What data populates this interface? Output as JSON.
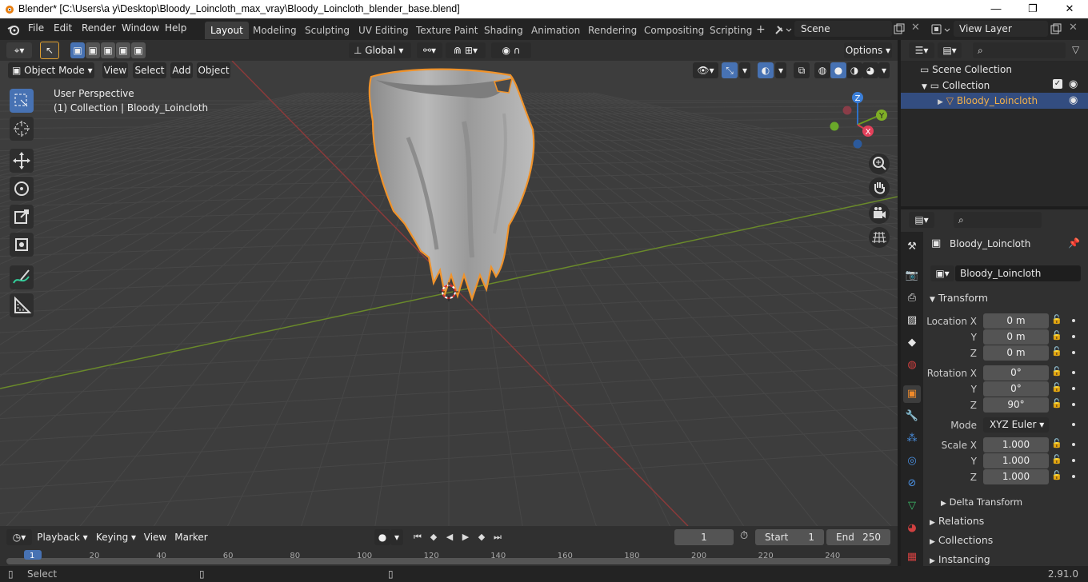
{
  "window": {
    "title": "Blender* [C:\\Users\\a y\\Desktop\\Bloody_Loincloth_max_vray\\Bloody_Loincloth_blender_base.blend]",
    "controls": [
      "—",
      "❐",
      "✕"
    ]
  },
  "menu": [
    "File",
    "Edit",
    "Render",
    "Window",
    "Help"
  ],
  "workspaces": [
    "Layout",
    "Modeling",
    "Sculpting",
    "UV Editing",
    "Texture Paint",
    "Shading",
    "Animation",
    "Rendering",
    "Compositing",
    "Scripting"
  ],
  "active_workspace": "Layout",
  "scene": {
    "value": "Scene"
  },
  "view_layer": {
    "value": "View Layer"
  },
  "viewport_header": {
    "transform_orientation": "Global",
    "options": "Options",
    "mode": "Object Mode",
    "menus": [
      "View",
      "Select",
      "Add",
      "Object"
    ]
  },
  "viewport": {
    "perspective": "User Perspective",
    "collection_info": "(1) Collection | Bloody_Loincloth"
  },
  "gizmo": {
    "z": "Z",
    "y": "Y",
    "x": "X"
  },
  "outliner": {
    "root": "Scene Collection",
    "collection": "Collection",
    "object": "Bloody_Loincloth"
  },
  "properties": {
    "object_name": "Bloody_Loincloth",
    "data_name": "Bloody_Loincloth",
    "transform_title": "Transform",
    "location_label": "Location X",
    "rotation_label": "Rotation X",
    "scale_label": "Scale X",
    "y_label": "Y",
    "z_label": "Z",
    "location": [
      "0 m",
      "0 m",
      "0 m"
    ],
    "rotation": [
      "0°",
      "0°",
      "90°"
    ],
    "mode_label": "Mode",
    "mode_value": "XYZ Euler",
    "scale": [
      "1.000",
      "1.000",
      "1.000"
    ],
    "delta_transform": "Delta Transform",
    "relations": "Relations",
    "collections": "Collections",
    "instancing": "Instancing"
  },
  "timeline": {
    "menus": [
      "Playback",
      "Keying",
      "View",
      "Marker"
    ],
    "current_frame": "1",
    "start_label": "Start",
    "start": "1",
    "end_label": "End",
    "end": "250",
    "ticks": [
      "1",
      "20",
      "40",
      "60",
      "80",
      "100",
      "120",
      "140",
      "160",
      "180",
      "200",
      "220",
      "240"
    ]
  },
  "status": {
    "left": "Select",
    "version": "2.91.0"
  },
  "colors": {
    "accent": "#4772b3",
    "selection_outline": "#f0932b",
    "x_axis": "#9b3a3a",
    "y_axis": "#6c8a2a"
  }
}
